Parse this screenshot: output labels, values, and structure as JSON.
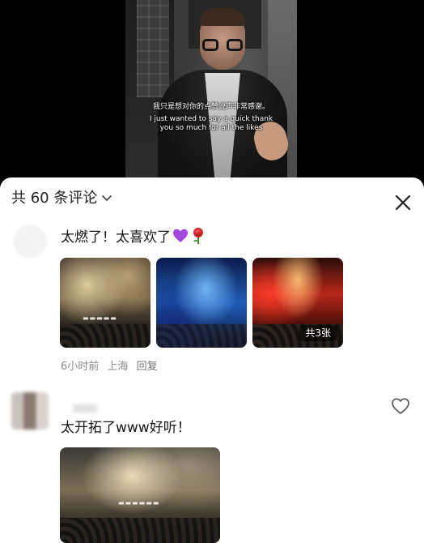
{
  "video": {
    "subtitle_cn": "我只是想对你的点赞说声非常感谢。",
    "subtitle_en": "I just wanted to say a quick thank you so much for all the likes"
  },
  "comments_panel": {
    "title": "共 60 条评论",
    "close_icon": "close-icon",
    "chevron_icon": "chevron-down-icon"
  },
  "comments": [
    {
      "text": "太燃了！太喜欢了",
      "emojis": [
        "purple-heart-icon",
        "rose-icon"
      ],
      "photos": [
        "concert-stage-photo",
        "blue-stage-photo",
        "red-stage-photo"
      ],
      "photo_count": "共3张",
      "time": "6小时前",
      "location": "上海",
      "reply": "回复"
    },
    {
      "text": "太开拓了www好听！",
      "like_icon": "heart-outline-icon",
      "photos": [
        "concert-stage-photo"
      ]
    }
  ],
  "colors": {
    "sheet_bg": "#ffffff",
    "text_primary": "#161616",
    "text_meta": "#8a8a8a"
  }
}
